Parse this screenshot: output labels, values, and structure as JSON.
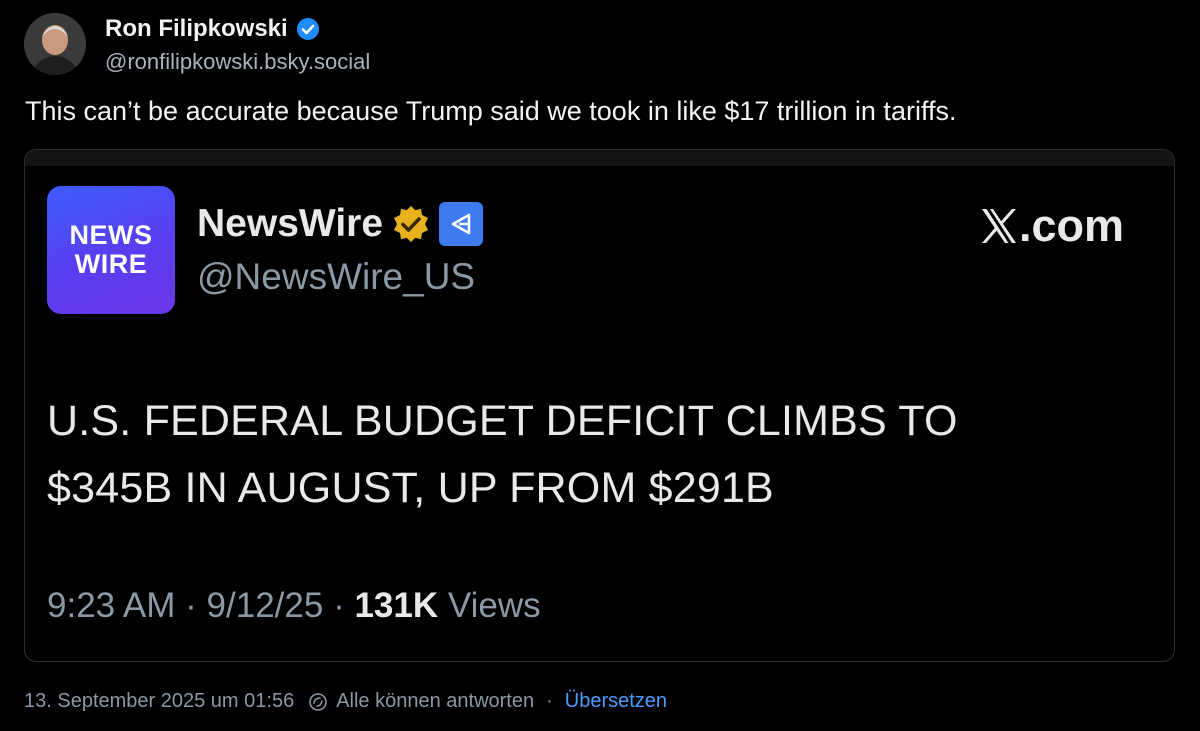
{
  "author": {
    "display_name": "Ron Filipkowski",
    "handle": "@ronfilipkowski.bsky.social",
    "avatar": "avatar-photo",
    "verified_icon": "verified-check-icon"
  },
  "post": {
    "text": "This can’t be accurate because Trump said we took in like $17 trillion in tariffs."
  },
  "embed": {
    "logo_line1": "NEWS",
    "logo_line2": "WIRE",
    "source_name": "NewsWire",
    "source_handle": "@NewsWire_US",
    "site_label": ".com",
    "headline_line1": "U.S. FEDERAL BUDGET DEFICIT CLIMBS TO",
    "headline_line2": "$345B IN AUGUST, UP FROM $291B",
    "time": "9:23 AM",
    "date": "9/12/25",
    "views_count": "131K",
    "views_label": "Views",
    "colors": {
      "logo_blue": "#3d5cff",
      "gold_badge": "#e8b21e",
      "gov_badge": "#3c7bf0"
    }
  },
  "footer": {
    "timestamp": "13. September 2025 um 01:56",
    "reply_setting": "Alle können antworten",
    "translate": "Übersetzen",
    "separator": "·",
    "colors": {
      "link": "#4d9bff"
    }
  }
}
